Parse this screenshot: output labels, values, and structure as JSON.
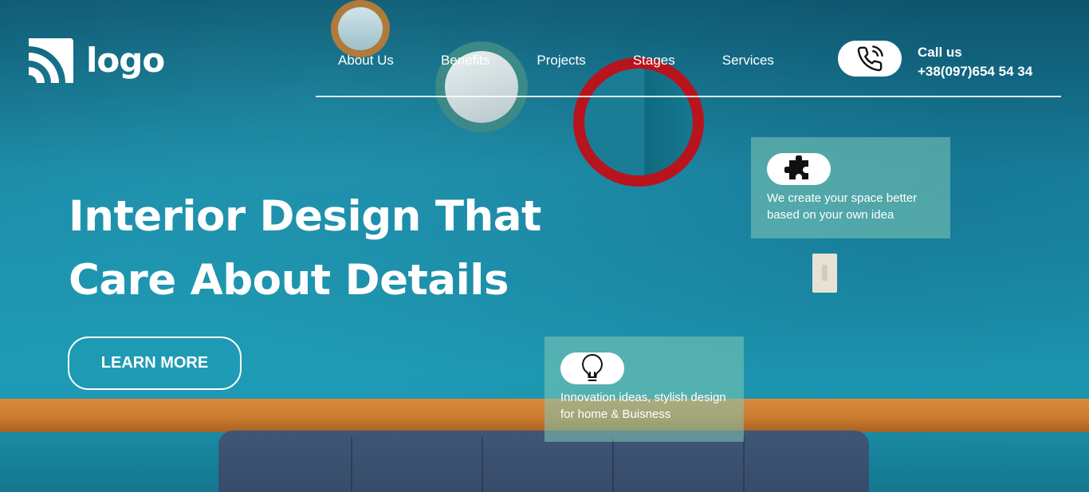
{
  "brand": {
    "logo_text": "logo"
  },
  "nav": {
    "items": [
      {
        "label": "About Us"
      },
      {
        "label": "Benefits"
      },
      {
        "label": "Projects"
      },
      {
        "label": "Stages"
      },
      {
        "label": "Services"
      }
    ]
  },
  "contact": {
    "call_label": "Call us",
    "phone": "+38(097)654 54 34",
    "icon": "phone-icon"
  },
  "hero": {
    "title_line1": "Interior Design That",
    "title_line2": "Care About Details",
    "cta_label": "LEARN MORE"
  },
  "cards": [
    {
      "icon": "puzzle-icon",
      "text": "We create your space better based on your own idea"
    },
    {
      "icon": "lightbulb-icon",
      "text": "Innovation ideas, stylish design for home & Buisness"
    }
  ],
  "colors": {
    "wall": "#1c8fa8",
    "card_bg": "#82c8b4",
    "text": "#ffffff",
    "rail": "#d88b3e",
    "sofa": "#3f5676"
  }
}
